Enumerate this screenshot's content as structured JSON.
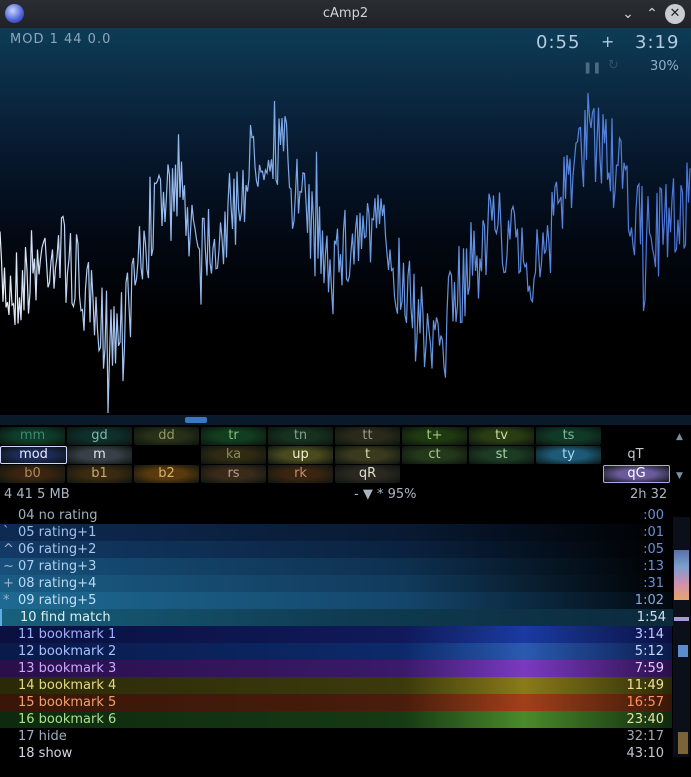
{
  "window": {
    "title": "cAmp2"
  },
  "player": {
    "mode": "MOD  1 44  0.0",
    "time_now": "0:55",
    "time_plus": "+",
    "time_total": "3:19",
    "volume": "30%"
  },
  "buttons": {
    "row1": [
      "mm",
      "gd",
      "dd",
      "tr",
      "tn",
      "tt",
      "t+",
      "tv",
      "ts",
      "",
      ""
    ],
    "row2": [
      "mod",
      "m",
      "",
      "ka",
      "up",
      "t",
      "ct",
      "st",
      "ty",
      "",
      "qT"
    ],
    "row3": [
      "b0",
      "b1",
      "b2",
      "rs",
      "rk",
      "qR",
      "",
      "",
      "",
      "",
      "qG"
    ]
  },
  "info": {
    "left": "4  41    5 MB",
    "filter": "-  ▼ *  95%",
    "right": "2h 32"
  },
  "playlist": [
    {
      "prefix": "",
      "label": "04 no rating",
      "time": ":00"
    },
    {
      "prefix": "`",
      "label": "05 rating+1",
      "time": ":01"
    },
    {
      "prefix": "^",
      "label": "06 rating+2",
      "time": ":05"
    },
    {
      "prefix": "~",
      "label": "07 rating+3",
      "time": ":13"
    },
    {
      "prefix": "+",
      "label": "08 rating+4",
      "time": ":31"
    },
    {
      "prefix": "*",
      "label": "09 rating+5",
      "time": "1:02"
    },
    {
      "prefix": "",
      "label": "10 find match",
      "time": "1:54"
    },
    {
      "prefix": "",
      "label": "11 bookmark 1",
      "time": "3:14"
    },
    {
      "prefix": "",
      "label": "12 bookmark 2",
      "time": "5:12"
    },
    {
      "prefix": "",
      "label": "13 bookmark 3",
      "time": "7:59"
    },
    {
      "prefix": "",
      "label": "14 bookmark 4",
      "time": "11:49"
    },
    {
      "prefix": "",
      "label": "15 bookmark 5",
      "time": "16:57"
    },
    {
      "prefix": "",
      "label": "16 bookmark 6",
      "time": "23:40"
    },
    {
      "prefix": "",
      "label": "17 hide",
      "time": "32:17"
    },
    {
      "prefix": "",
      "label": "18 show",
      "time": "43:10"
    }
  ],
  "icons": {
    "app": "camp-logo-icon",
    "minimize": "chevron-down-icon",
    "maximize": "chevron-up-icon",
    "close": "close-icon",
    "pause": "pause-icon",
    "repeat": "repeat-icon",
    "scroll_up": "triangle-up-icon",
    "scroll_down": "triangle-down-icon"
  }
}
